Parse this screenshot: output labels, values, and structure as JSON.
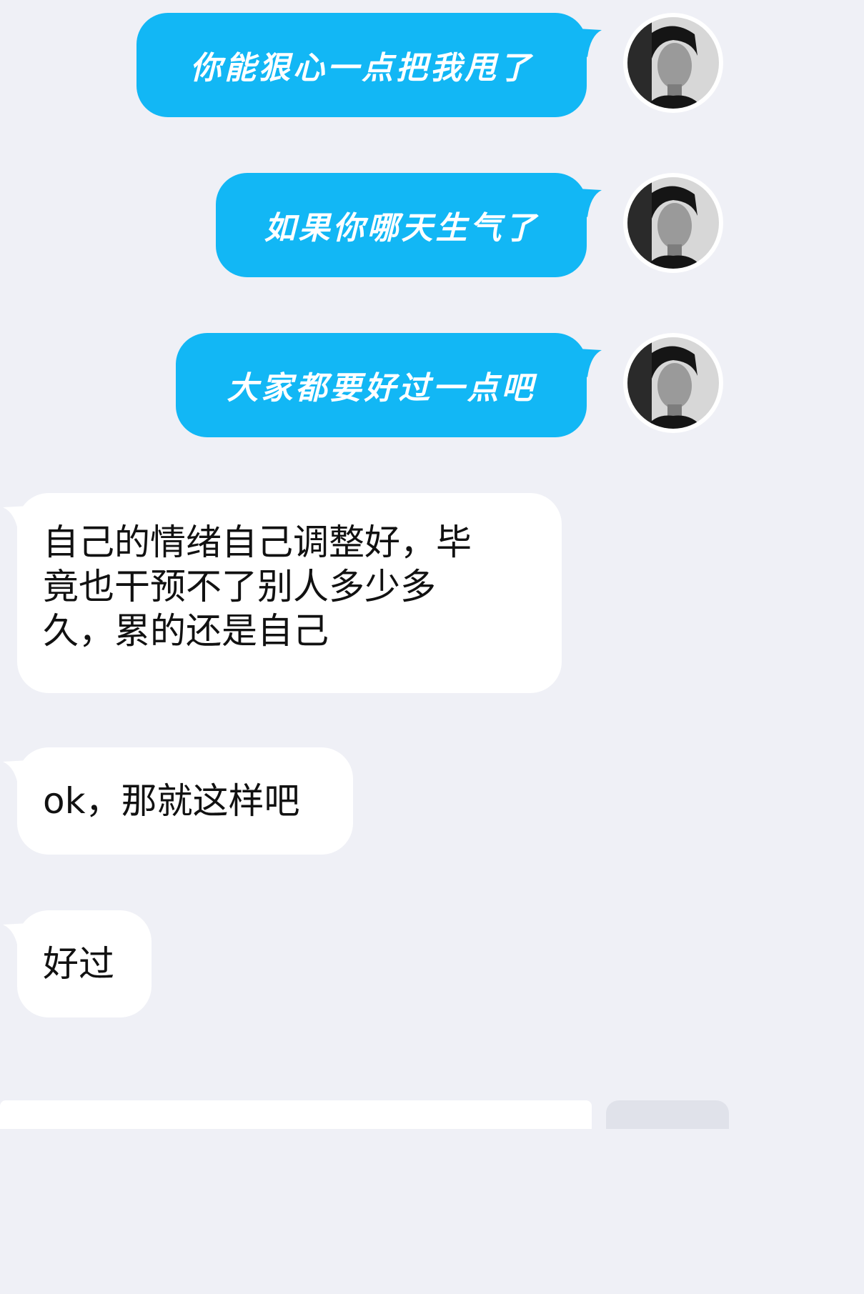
{
  "messages": [
    {
      "side": "out",
      "text": "你能狠心一点把我甩了"
    },
    {
      "side": "out",
      "text": "如果你哪天生气了"
    },
    {
      "side": "out",
      "text": "大家都要好过一点吧"
    },
    {
      "side": "in",
      "lines": [
        "自己的情绪自己调整好，毕",
        "竟也干预不了别人多少多",
        "久，累的还是自己"
      ]
    },
    {
      "side": "in",
      "text": "ok，那就这样吧"
    },
    {
      "side": "in",
      "text": "好过"
    }
  ],
  "colors": {
    "outgoing_bubble": "#12b7f5",
    "incoming_bubble": "#ffffff",
    "background": "#eff0f6"
  },
  "icons": {
    "avatar": "user-avatar-portrait"
  }
}
